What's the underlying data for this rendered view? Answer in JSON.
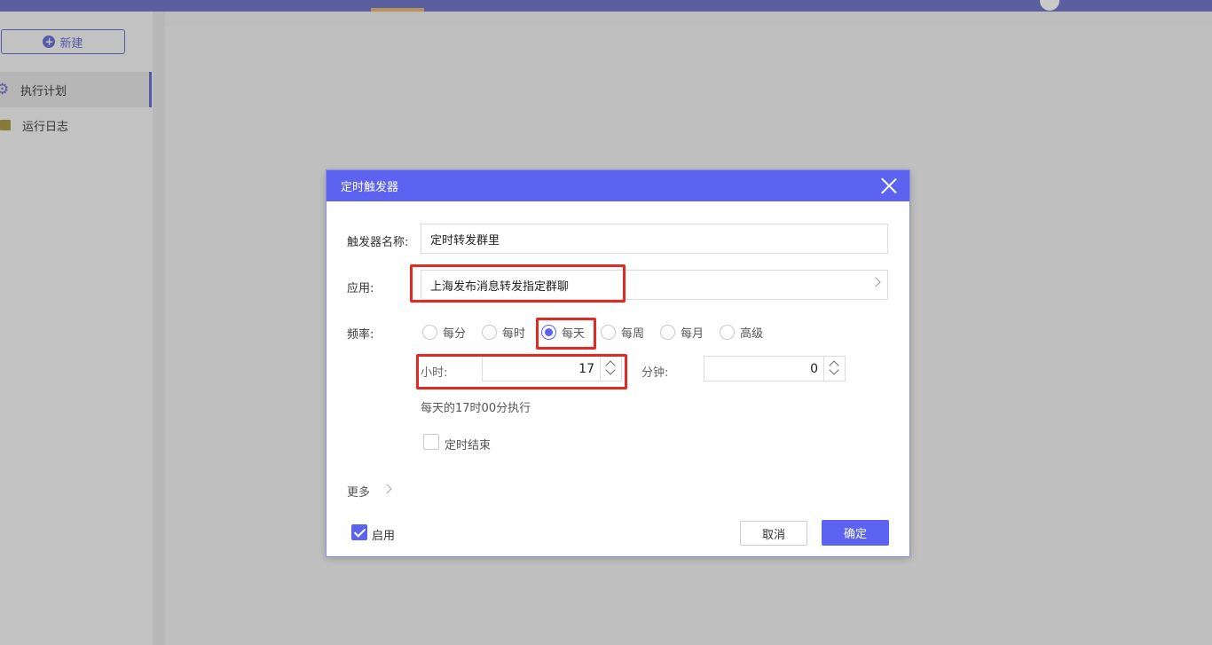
{
  "sidebar": {
    "new_button": "新建",
    "items": [
      {
        "label": "执行计划",
        "icon": "gear-icon",
        "active": true
      },
      {
        "label": "运行日志",
        "icon": "log-icon",
        "active": false
      }
    ]
  },
  "dialog": {
    "title": "定时触发器",
    "trigger_name_label": "触发器名称:",
    "trigger_name_value": "定时转发群里",
    "app_label": "应用:",
    "app_value": "上海发布消息转发指定群聊",
    "frequency_label": "频率:",
    "frequency_options": [
      "每分",
      "每时",
      "每天",
      "每周",
      "每月",
      "高级"
    ],
    "frequency_selected": "每天",
    "hour_label": "小时:",
    "hour_value": "17",
    "minute_label": "分钟:",
    "minute_value": "0",
    "schedule_hint": "每天的17时00分执行",
    "timed_end_label": "定时结束",
    "more_label": "更多",
    "enable_label": "启用",
    "cancel_label": "取消",
    "ok_label": "确定"
  },
  "colors": {
    "accent": "#5c63f0",
    "highlight": "#e12a22",
    "topbar": "#5a5fa0"
  }
}
